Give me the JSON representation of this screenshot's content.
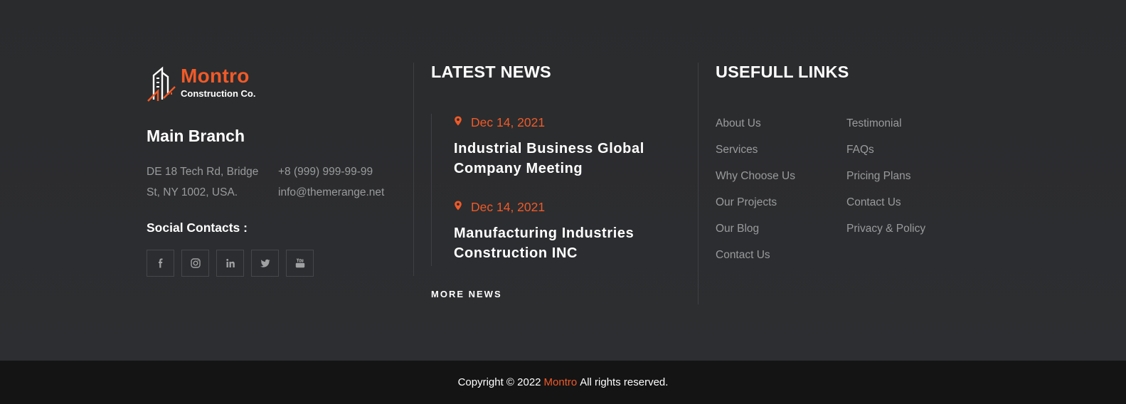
{
  "brand": {
    "name": "Montro",
    "tagline": "Construction Co.",
    "accent_color": "#f05a28"
  },
  "branch": {
    "title": "Main Branch",
    "address_line1": "DE 18 Tech Rd, Bridge",
    "address_line2": "St, NY 1002, USA.",
    "phone": "+8 (999) 999-99-99",
    "email": "info@themerange.net"
  },
  "social": {
    "title": "Social Contacts :",
    "icons": [
      "facebook-icon",
      "instagram-icon",
      "linkedin-icon",
      "twitter-icon",
      "youtube-icon"
    ]
  },
  "news": {
    "title": "LATEST NEWS",
    "items": [
      {
        "date": "Dec 14, 2021",
        "title": "Industrial Business Global Company Meeting"
      },
      {
        "date": "Dec 14, 2021",
        "title": "Manufacturing Industries Construction INC"
      }
    ],
    "more_label": "MORE NEWS"
  },
  "links": {
    "title": "USEFULL LINKS",
    "col1": [
      "About Us",
      "Services",
      "Why Choose Us",
      "Our Projects",
      "Our Blog",
      "Contact Us"
    ],
    "col2": [
      "Testimonial",
      "FAQs",
      "Pricing Plans",
      "Contact Us",
      "Privacy & Policy"
    ]
  },
  "copyright": {
    "prefix": "Copyright © 2022",
    "brand": "Montro",
    "suffix": "All rights reserved."
  }
}
